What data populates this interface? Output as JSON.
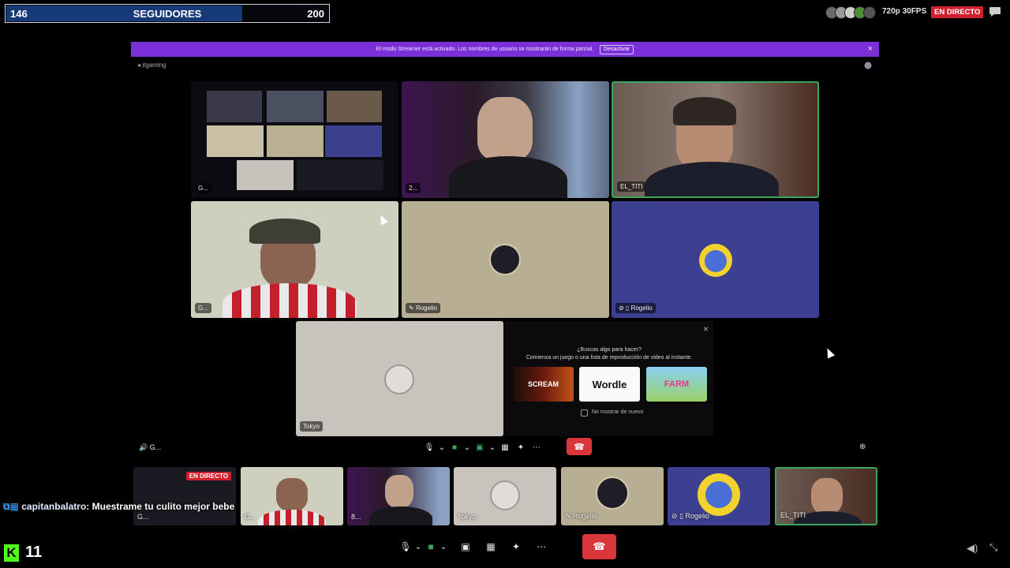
{
  "follower_goal": {
    "current": "146",
    "label": "SEGUIDORES",
    "goal": "200",
    "progress": 0.73
  },
  "stream": {
    "resolution": "720p 30FPS",
    "live": "EN DIRECTO"
  },
  "discord": {
    "streamer_mode_text": "El modo Streamer está activado. Los nombres de usuario se mostrarán de forma parcial.",
    "streamer_mode_button": "Desactivar",
    "channel": "gaming",
    "tiles": {
      "screen": "G...",
      "user2": "2...",
      "titi": "EL_TITI",
      "g_cam": "G...",
      "rogelio1": "Rogelio",
      "rogelio2": "Rogelio",
      "tokyo": "Tokyo"
    },
    "activities": {
      "heading": "¿Buscas algo para hacer?",
      "subheading": "Comienza un juego o una lista de reproducción de video al instante.",
      "games": [
        "SCREAM",
        "Wordle",
        "FARM"
      ],
      "dont_show": "No mostrar de nuevo"
    },
    "group_label": "G...",
    "strip": {
      "s1": "G...",
      "s1_live": "EN DIRECTO",
      "s2": "G...",
      "s3": "8...",
      "s4": "Tokyo",
      "s5": "Rogelio",
      "s6": "Rogelio",
      "s7": "EL_TITI"
    }
  },
  "chat": {
    "user": "capitanbalatro",
    "message": ": Muestrame tu culito mejor bebe"
  },
  "viewers": "11",
  "colors": {
    "accent": "#7b2fd8",
    "live": "#d1202d",
    "kick": "#53fc18",
    "hangup": "#da373c"
  }
}
